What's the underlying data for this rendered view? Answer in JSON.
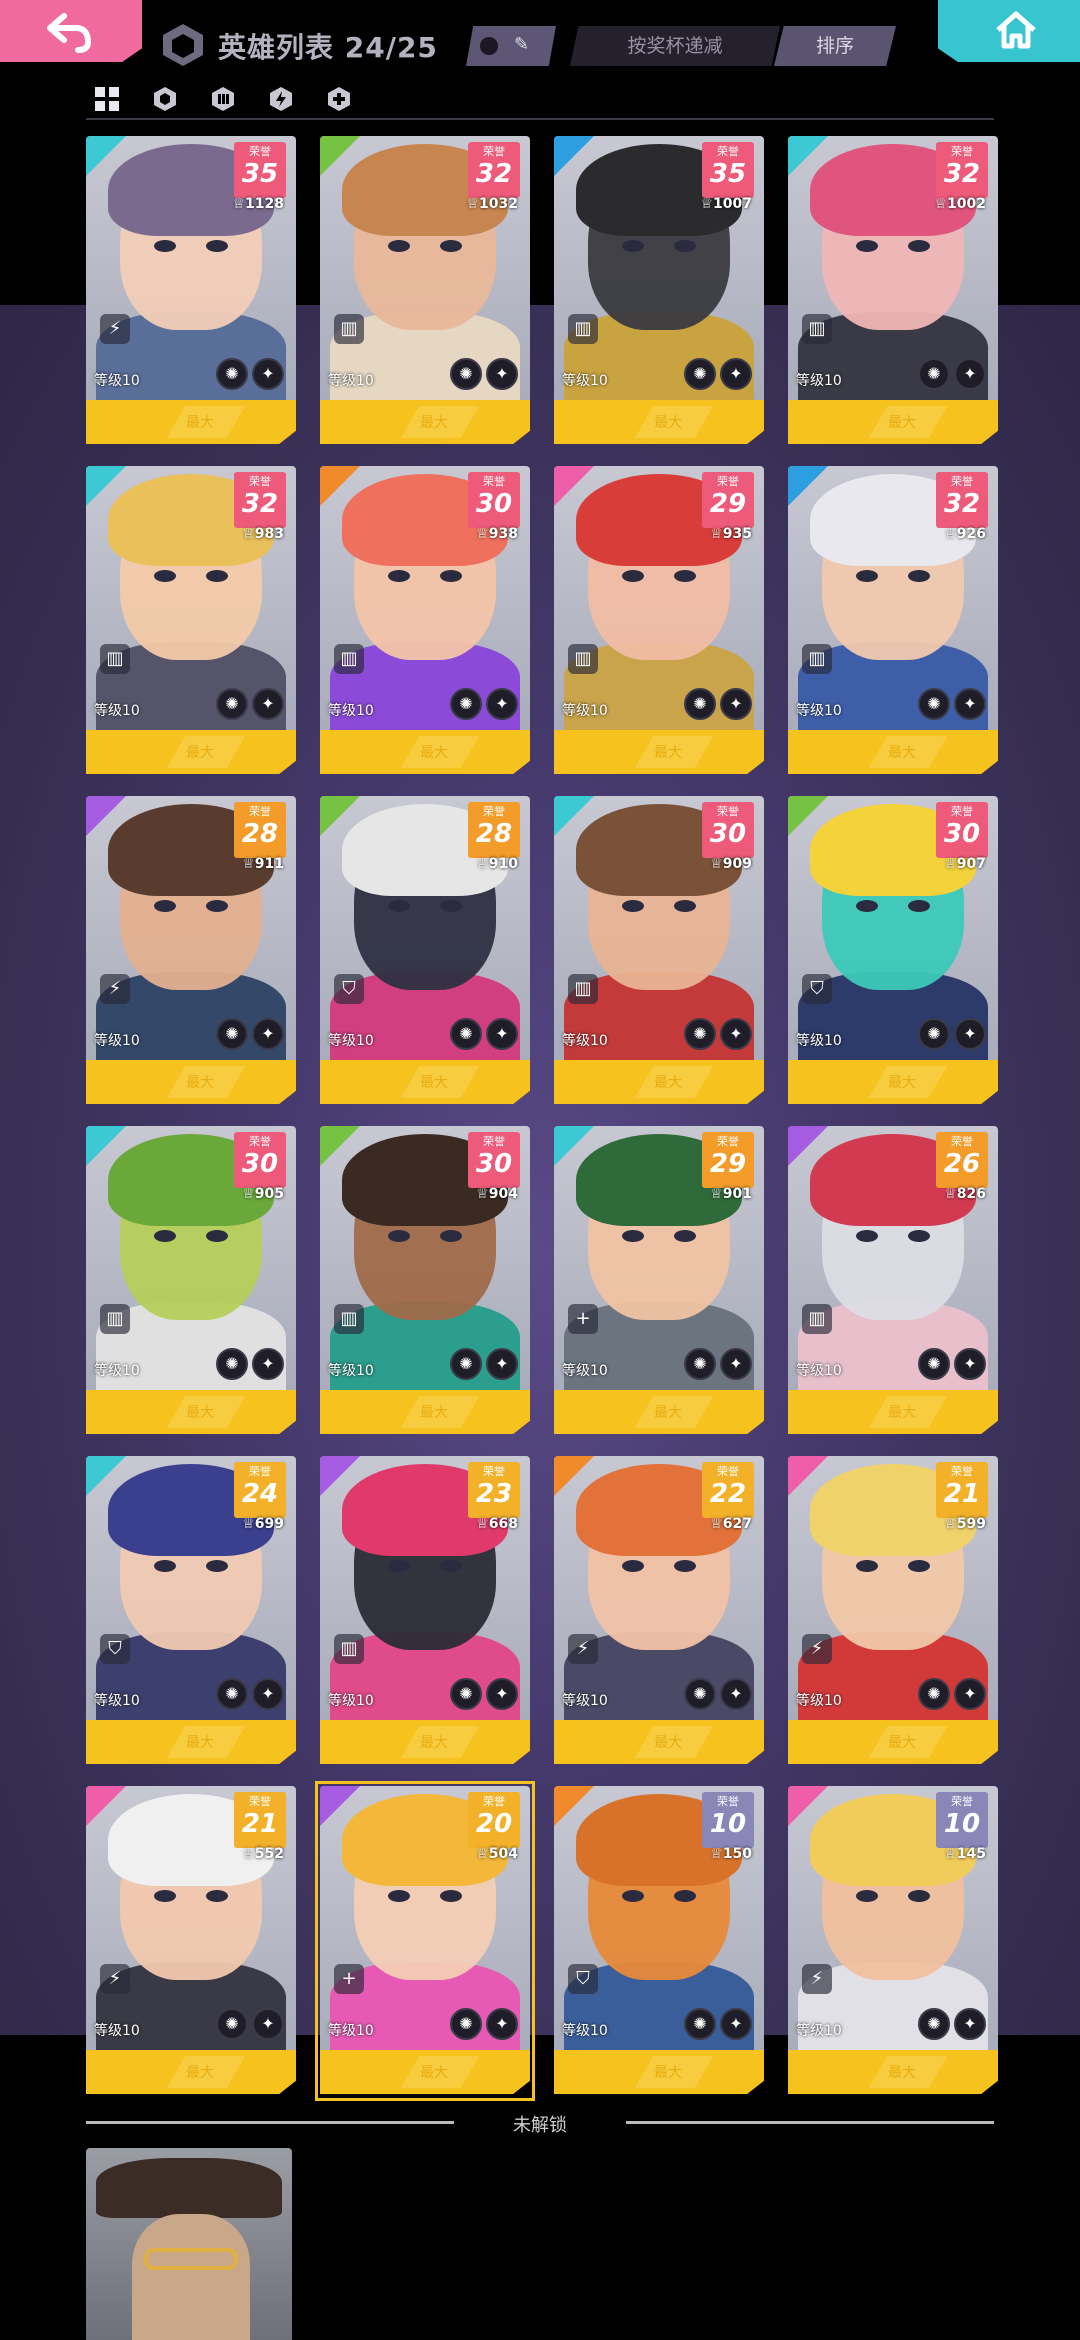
{
  "header": {
    "title": "英雄列表 24/25",
    "filter_label": "按奖杯递减",
    "sort_label": "排序",
    "toggle_icon": "ticket-icon"
  },
  "tabs": [
    {
      "name": "all-heroes-tab",
      "icon": "grid-icon"
    },
    {
      "name": "tank-tab",
      "icon": "shield-icon"
    },
    {
      "name": "support-tab",
      "icon": "armor-icon"
    },
    {
      "name": "attack-tab",
      "icon": "lightning-icon"
    },
    {
      "name": "healer-tab",
      "icon": "plus-icon"
    }
  ],
  "card_common": {
    "rank_label": "荣誉",
    "level_label": "等级10",
    "bar_label": "最大"
  },
  "heroes": [
    {
      "rank": "35",
      "cups": "1128",
      "class_icon": "⚡",
      "accent": "#3cc9d4",
      "rank_color": "#ee5b7a",
      "skin": "#f2cdb8",
      "hair": "#7a6a8e",
      "outfit": "#5a6e9a"
    },
    {
      "rank": "32",
      "cups": "1032",
      "class_icon": "▥",
      "accent": "#76c243",
      "rank_color": "#ee5b7a",
      "skin": "#e9b79a",
      "hair": "#c7854f",
      "outfit": "#e6d7c3"
    },
    {
      "rank": "35",
      "cups": "1007",
      "class_icon": "▥",
      "accent": "#2d9fe0",
      "rank_color": "#ee5b7a",
      "skin": "#3a3a40",
      "hair": "#2b2b2e",
      "outfit": "#c9a340"
    },
    {
      "rank": "32",
      "cups": "1002",
      "class_icon": "▥",
      "accent": "#3cc9d4",
      "rank_color": "#ee5b7a",
      "skin": "#f0b6b6",
      "hair": "#e0557d",
      "outfit": "#3a3a46"
    },
    {
      "rank": "32",
      "cups": "983",
      "class_icon": "▥",
      "accent": "#3cc9d4",
      "rank_color": "#ee5b7a",
      "skin": "#f2caa9",
      "hair": "#e9c05a",
      "outfit": "#55546a"
    },
    {
      "rank": "30",
      "cups": "938",
      "class_icon": "▥",
      "accent": "#f08a2a",
      "rank_color": "#ee5b7a",
      "skin": "#f3c4a9",
      "hair": "#f0705e",
      "outfit": "#8b4bd8"
    },
    {
      "rank": "29",
      "cups": "935",
      "class_icon": "▥",
      "accent": "#ef5ea8",
      "rank_color": "#ee5b7a",
      "skin": "#f1bda4",
      "hair": "#d93d3a",
      "outfit": "#c9a44a"
    },
    {
      "rank": "32",
      "cups": "926",
      "class_icon": "▥",
      "accent": "#2d9fe0",
      "rank_color": "#ee5b7a",
      "skin": "#f1c9ae",
      "hair": "#e8e8ee",
      "outfit": "#3e5ea8"
    },
    {
      "rank": "28",
      "cups": "911",
      "class_icon": "⚡",
      "accent": "#a55ce0",
      "rank_color": "#f39c2a",
      "skin": "#e3b08f",
      "hair": "#5a3c2e",
      "outfit": "#34496a"
    },
    {
      "rank": "28",
      "cups": "910",
      "class_icon": "⛉",
      "accent": "#76c243",
      "rank_color": "#f39c2a",
      "skin": "#2e3042",
      "hair": "#e6e6e6",
      "outfit": "#d23f80"
    },
    {
      "rank": "30",
      "cups": "909",
      "class_icon": "▥",
      "accent": "#3cc9d4",
      "rank_color": "#ee5b7a",
      "skin": "#e8b394",
      "hair": "#7a5238",
      "outfit": "#c43a3a"
    },
    {
      "rank": "30",
      "cups": "907",
      "class_icon": "⛉",
      "accent": "#76c243",
      "rank_color": "#ee5b7a",
      "skin": "#3cc9b8",
      "hair": "#f3d23a",
      "outfit": "#2d3b6a"
    },
    {
      "rank": "30",
      "cups": "905",
      "class_icon": "▥",
      "accent": "#3cc9d4",
      "rank_color": "#ee5b7a",
      "skin": "#b4cf5a",
      "hair": "#6aa83a",
      "outfit": "#e0e0e0"
    },
    {
      "rank": "30",
      "cups": "904",
      "class_icon": "▥",
      "accent": "#76c243",
      "rank_color": "#ee5b7a",
      "skin": "#a06a4a",
      "hair": "#3a2a22",
      "outfit": "#2c9e8e"
    },
    {
      "rank": "29",
      "cups": "901",
      "class_icon": "+",
      "accent": "#3cc9d4",
      "rank_color": "#f39c2a",
      "skin": "#f0c3a3",
      "hair": "#2f6a3a",
      "outfit": "#6c7480"
    },
    {
      "rank": "26",
      "cups": "826",
      "class_icon": "▥",
      "accent": "#a55ce0",
      "rank_color": "#f39c2a",
      "skin": "#dcdce4",
      "hair": "#d23a52",
      "outfit": "#e7c0cc"
    },
    {
      "rank": "24",
      "cups": "699",
      "class_icon": "⛉",
      "accent": "#3cc9d4",
      "rank_color": "#f3b12a",
      "skin": "#f0c9b2",
      "hair": "#3a3f8e",
      "outfit": "#3d3f6e"
    },
    {
      "rank": "23",
      "cups": "668",
      "class_icon": "▥",
      "accent": "#a55ce0",
      "rank_color": "#f3b12a",
      "skin": "#2b2b36",
      "hair": "#e03a6a",
      "outfit": "#e04b8a"
    },
    {
      "rank": "22",
      "cups": "627",
      "class_icon": "⚡",
      "accent": "#f08a2a",
      "rank_color": "#f3b12a",
      "skin": "#f1c2a6",
      "hair": "#e2713a",
      "outfit": "#4a4a66"
    },
    {
      "rank": "21",
      "cups": "599",
      "class_icon": "⚡",
      "accent": "#ef5ea8",
      "rank_color": "#f3b12a",
      "skin": "#f1c7a8",
      "hair": "#f0d26a",
      "outfit": "#d23a3a"
    },
    {
      "rank": "21",
      "cups": "552",
      "class_icon": "⚡",
      "accent": "#ef5ea8",
      "rank_color": "#f3b12a",
      "skin": "#f1c8ae",
      "hair": "#f0f0f0",
      "outfit": "#3a3a46"
    },
    {
      "rank": "20",
      "cups": "504",
      "class_icon": "+",
      "accent": "#a55ce0",
      "rank_color": "#f3b12a",
      "skin": "#f4cdb5",
      "hair": "#f3b83a",
      "outfit": "#e65ab3"
    },
    {
      "rank": "10",
      "cups": "150",
      "class_icon": "⛉",
      "accent": "#f08a2a",
      "rank_color": "#8a86b8",
      "skin": "#e8893a",
      "hair": "#d8722a",
      "outfit": "#3a5e9a"
    },
    {
      "rank": "10",
      "cups": "145",
      "class_icon": "⚡",
      "accent": "#ef5ea8",
      "rank_color": "#8a86b8",
      "skin": "#f0c09e",
      "hair": "#f2cc5a",
      "outfit": "#e0e0e6"
    }
  ],
  "unlock_section": {
    "label": "未解锁"
  },
  "selected_index": 21
}
